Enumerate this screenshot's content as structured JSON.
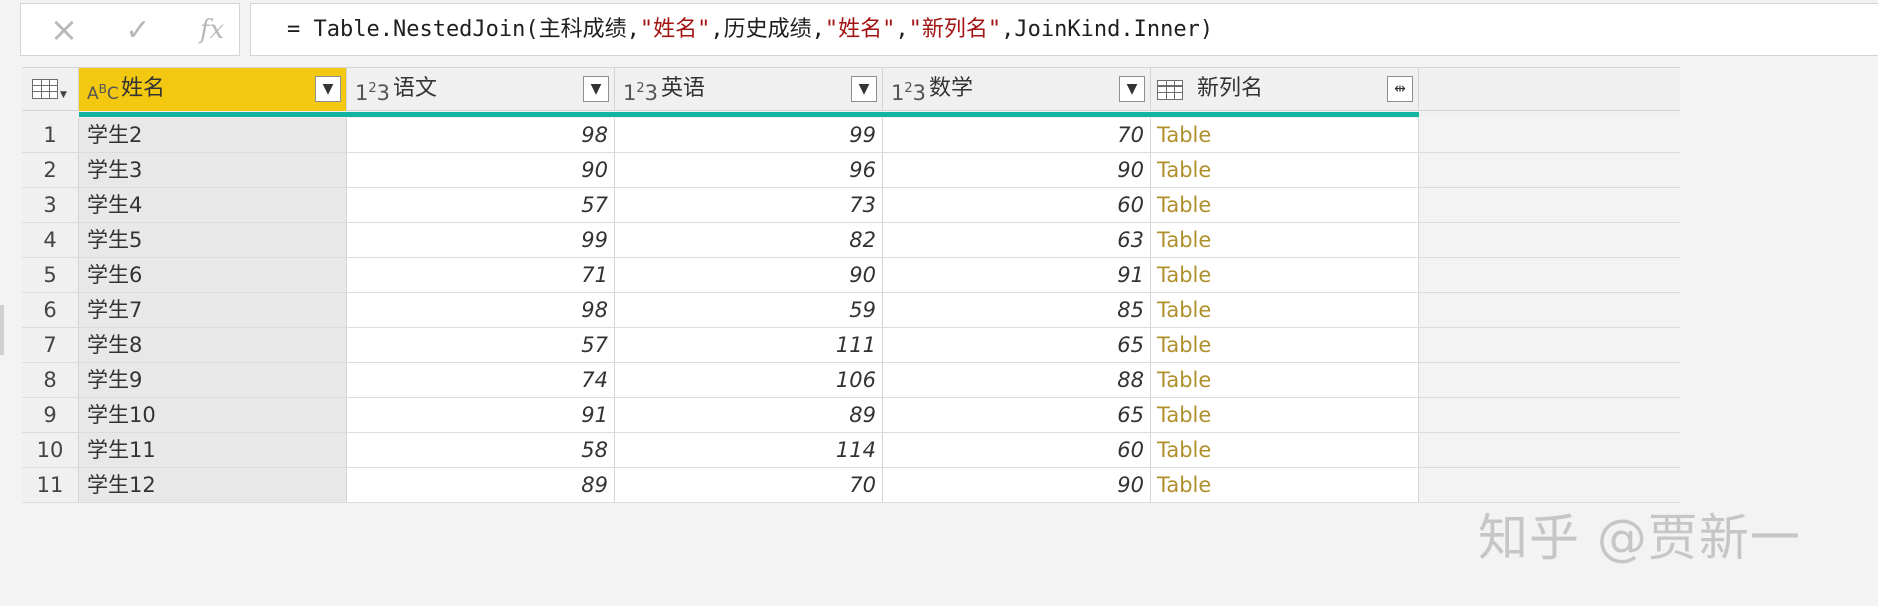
{
  "formula_bar": {
    "cancel_icon": "×",
    "commit_icon": "✓",
    "fx_label": "fx",
    "formula_parts": [
      {
        "text": "= Table.NestedJoin(主科成绩,",
        "kind": "code"
      },
      {
        "text": "\"姓名\"",
        "kind": "str"
      },
      {
        "text": ",历史成绩,",
        "kind": "code"
      },
      {
        "text": "\"姓名\"",
        "kind": "str"
      },
      {
        "text": ",",
        "kind": "code"
      },
      {
        "text": "\"新列名\"",
        "kind": "str"
      },
      {
        "text": ",JoinKind.Inner)",
        "kind": "code"
      }
    ]
  },
  "columns": [
    {
      "key": "name",
      "header": "姓名",
      "type_icon": "text-type-icon",
      "selected": true
    },
    {
      "key": "chinese",
      "header": "语文",
      "type_icon": "number-type-icon",
      "selected": false
    },
    {
      "key": "english",
      "header": "英语",
      "type_icon": "number-type-icon",
      "selected": false
    },
    {
      "key": "math",
      "header": "数学",
      "type_icon": "number-type-icon",
      "selected": false
    },
    {
      "key": "newcol",
      "header": "新列名",
      "type_icon": "table-type-icon",
      "selected": false
    }
  ],
  "rows": [
    {
      "idx": "1",
      "name": "学生2",
      "chinese": "98",
      "english": "99",
      "math": "70",
      "newcol": "Table"
    },
    {
      "idx": "2",
      "name": "学生3",
      "chinese": "90",
      "english": "96",
      "math": "90",
      "newcol": "Table"
    },
    {
      "idx": "3",
      "name": "学生4",
      "chinese": "57",
      "english": "73",
      "math": "60",
      "newcol": "Table"
    },
    {
      "idx": "4",
      "name": "学生5",
      "chinese": "99",
      "english": "82",
      "math": "63",
      "newcol": "Table"
    },
    {
      "idx": "5",
      "name": "学生6",
      "chinese": "71",
      "english": "90",
      "math": "91",
      "newcol": "Table"
    },
    {
      "idx": "6",
      "name": "学生7",
      "chinese": "98",
      "english": "59",
      "math": "85",
      "newcol": "Table"
    },
    {
      "idx": "7",
      "name": "学生8",
      "chinese": "57",
      "english": "111",
      "math": "65",
      "newcol": "Table"
    },
    {
      "idx": "8",
      "name": "学生9",
      "chinese": "74",
      "english": "106",
      "math": "88",
      "newcol": "Table"
    },
    {
      "idx": "9",
      "name": "学生10",
      "chinese": "91",
      "english": "89",
      "math": "65",
      "newcol": "Table"
    },
    {
      "idx": "10",
      "name": "学生11",
      "chinese": "58",
      "english": "114",
      "math": "60",
      "newcol": "Table"
    },
    {
      "idx": "11",
      "name": "学生12",
      "chinese": "89",
      "english": "70",
      "math": "90",
      "newcol": "Table"
    }
  ],
  "watermark": "知乎 @贾新一",
  "colors": {
    "selected_header": "#f2c811",
    "quality_bar": "#13b3a3",
    "table_link": "#b0902d",
    "formula_string": "#a31515"
  }
}
